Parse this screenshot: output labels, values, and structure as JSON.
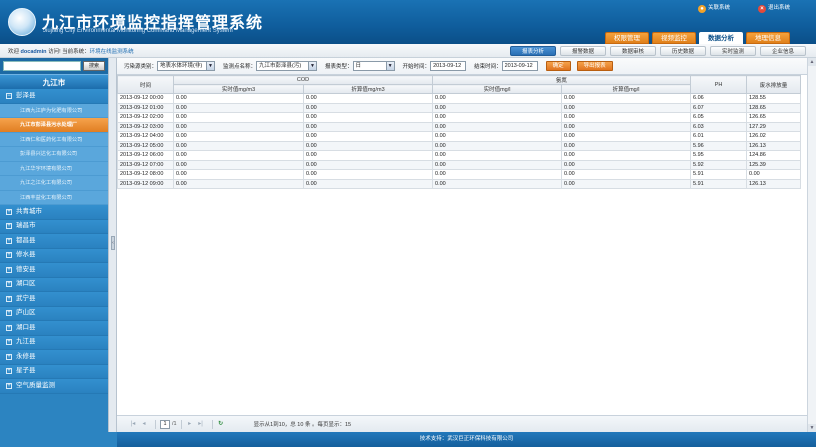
{
  "header": {
    "title": "九江市环境监控指挥管理系统",
    "subtitle": "Jiujiang City Environmental Monitoring Command Management System",
    "links": [
      {
        "label": "关联系统",
        "icon": "link-icon",
        "color": "#f2a22a"
      },
      {
        "label": "退出系统",
        "icon": "logout-icon",
        "color": "#e34a3a"
      }
    ],
    "nav": [
      "权限管理",
      "视频监控",
      "数据分析",
      "地理信息"
    ],
    "active_nav": "数据分析"
  },
  "subbar": {
    "welcome_prefix": "欢迎",
    "user": "docadmin",
    "welcome_mid": "访问! 当前系统：",
    "system_name": "环境在线监测系统",
    "tabs": [
      "报表分析",
      "报警数据",
      "数据审核",
      "历史数据",
      "实时监测",
      "企业信息"
    ],
    "active_tab": "报表分析"
  },
  "sidebar": {
    "search_placeholder": "",
    "search_button": "搜索",
    "city": "九江市",
    "expanded": "彭泽县",
    "companies": [
      "江西九江庐为化肥有限公司",
      "九江市彭泽县污水处理厂",
      "江西仁和医药化工有限公司",
      "彭泽县兴达化工有限公司",
      "九江华宇环境有限公司",
      "九江之江化工有限公司",
      "江西丰益化工有限公司"
    ],
    "active_company": "九江市彭泽县污水处理厂",
    "regions": [
      "共青城市",
      "瑞昌市",
      "都昌县",
      "修水县",
      "德安县",
      "湖口区",
      "武宁县",
      "庐山区",
      "湖口县",
      "九江县",
      "永修县",
      "星子县",
      "空气质量监测"
    ]
  },
  "filter": {
    "pollution_type_label": "污染源类别：",
    "pollution_type_value": "地表水体环境(非)",
    "site_label": "监测点名称：",
    "site_value": "九江市彭泽县(污)",
    "report_type_label": "报表类型：",
    "report_type_value": "日",
    "start_label": "开始时间：",
    "start_value": "2013-09-12",
    "end_label": "结束时间：",
    "end_value": "2013-09-12",
    "confirm": "确定",
    "export": "导出报表"
  },
  "table": {
    "h_time": "时间",
    "h_cod": "COD",
    "h_ammonia": "氨氮",
    "h_ph": "PH",
    "h_flow": "废水排放量",
    "sub_cod_rt": "实时值mg/m3",
    "sub_cod_conv": "折算值mg/m3",
    "sub_nh_rt": "实时值mg/l",
    "sub_nh_conv": "折算值mg/l",
    "rows": [
      [
        "2013-09-12 00:00",
        "0.00",
        "0.00",
        "0.00",
        "0.00",
        "6.06",
        "128.55"
      ],
      [
        "2013-09-12 01:00",
        "0.00",
        "0.00",
        "0.00",
        "0.00",
        "6.07",
        "128.65"
      ],
      [
        "2013-09-12 02:00",
        "0.00",
        "0.00",
        "0.00",
        "0.00",
        "6.05",
        "126.65"
      ],
      [
        "2013-09-12 03:00",
        "0.00",
        "0.00",
        "0.00",
        "0.00",
        "6.03",
        "127.29"
      ],
      [
        "2013-09-12 04:00",
        "0.00",
        "0.00",
        "0.00",
        "0.00",
        "6.01",
        "126.02"
      ],
      [
        "2013-09-12 05:00",
        "0.00",
        "0.00",
        "0.00",
        "0.00",
        "5.96",
        "126.13"
      ],
      [
        "2013-09-12 06:00",
        "0.00",
        "0.00",
        "0.00",
        "0.00",
        "5.95",
        "124.86"
      ],
      [
        "2013-09-12 07:00",
        "0.00",
        "0.00",
        "0.00",
        "0.00",
        "5.92",
        "125.39"
      ],
      [
        "2013-09-12 08:00",
        "0.00",
        "0.00",
        "0.00",
        "0.00",
        "5.91",
        "0.00"
      ],
      [
        "2013-09-12 09:00",
        "0.00",
        "0.00",
        "0.00",
        "0.00",
        "5.91",
        "126.13"
      ]
    ]
  },
  "pager": {
    "page": "1",
    "total_pages": "/1",
    "info": "显示从1到10，总 10 条 。每页显示：15"
  },
  "footer": {
    "text": "技术支持：武汉巨正环保科技有限公司"
  }
}
